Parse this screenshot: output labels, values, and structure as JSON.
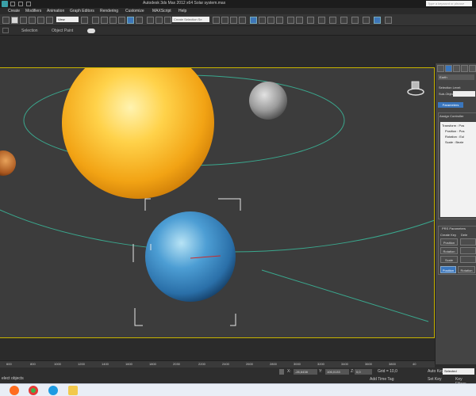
{
  "window": {
    "title": "Autodesk 3ds Max 2012 x64      Solar system.max",
    "help_search_placeholder": "Type a keyword or phrase"
  },
  "menubar": {
    "items": [
      "Create",
      "Modifiers",
      "Animation",
      "Graph Editors",
      "Rendering",
      "Customize",
      "MAXScript",
      "Help"
    ]
  },
  "toolbar": {
    "view_dropdown": "View",
    "selection_set_placeholder": "Create Selection Se"
  },
  "ribbon": {
    "items": [
      "Selection",
      "Object Paint"
    ]
  },
  "command_panel": {
    "object_name": "Earth",
    "selection_level_label": "Selection Level:",
    "sub_object_label": "Sub-Object:",
    "parameters_button": "Parameters",
    "assign_controller_label": "Assign Controller",
    "tree_items": [
      "Transform : Pos",
      "Position : Pos",
      "Rotation : Eul",
      "Scale : Bezie"
    ],
    "prs_label": "PRS Parameters",
    "create_key_label": "Create Key",
    "delete_label": "Dele",
    "position_button": "Position",
    "rotation_button": "Rotation",
    "scale_button": "Scale",
    "position_tab": "Position",
    "rotation_tab": "Rotation"
  },
  "timeline": {
    "ticks": [
      "600",
      "800",
      "1000",
      "1200",
      "1400",
      "1600",
      "1800",
      "2030",
      "2200",
      "2400",
      "2600",
      "2800",
      "3000",
      "3200",
      "3400",
      "3600",
      "3800",
      "40"
    ]
  },
  "status": {
    "selected_text": "elect objects",
    "x_label": "X:",
    "x_value": "-26,6438",
    "y_label": "Y:",
    "y_value": "106,0133",
    "z_label": "Z:",
    "z_value": "0,0",
    "grid": "Grid = 10,0",
    "add_time_tag": "Add Time Tag",
    "auto_key": "Auto Key",
    "auto_key_value": "Selected",
    "set_key": "Set Key",
    "key_filters": "Key Filters..."
  },
  "colors": {
    "accent": "#3a76bd",
    "viewport_border": "#c8b400",
    "orbit": "#3aa88e",
    "sun": "#f5b21c",
    "earth": "#3d8cc6"
  }
}
